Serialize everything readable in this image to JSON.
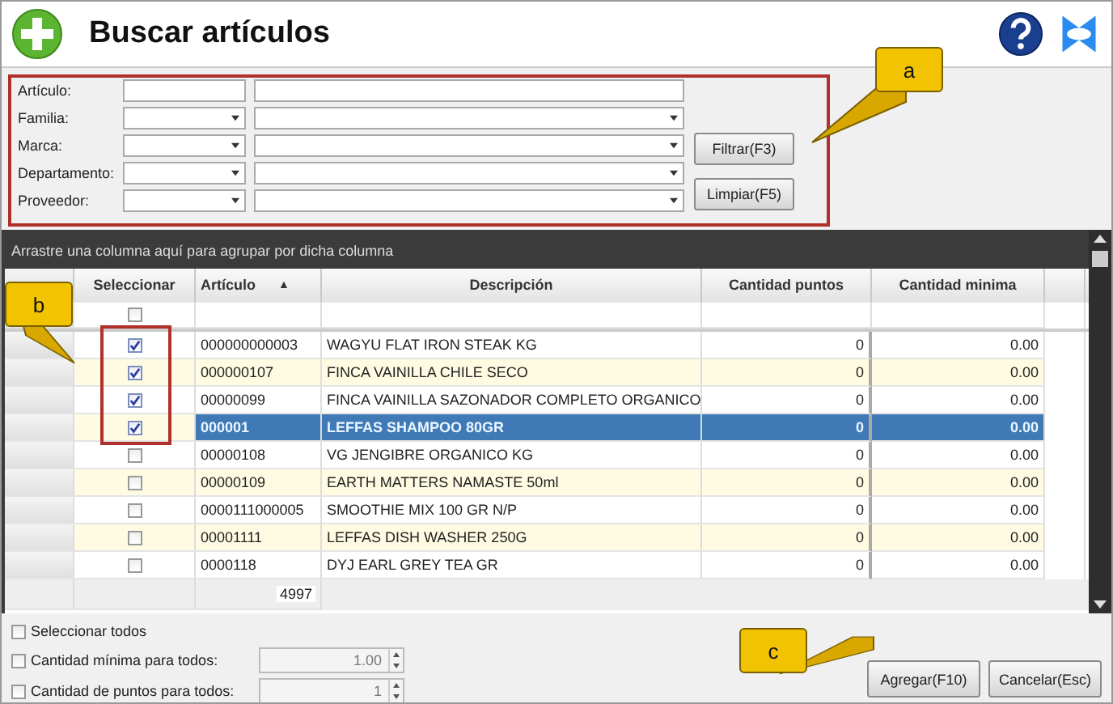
{
  "title": "Buscar artículos",
  "filters": [
    {
      "label": "Artículo:",
      "kind": "text"
    },
    {
      "label": "Familia:",
      "kind": "combo"
    },
    {
      "label": "Marca:",
      "kind": "combo"
    },
    {
      "label": "Departamento:",
      "kind": "combo"
    },
    {
      "label": "Proveedor:",
      "kind": "combo"
    }
  ],
  "filter_buttons": [
    "Filtrar(F3)",
    "Limpiar(F5)"
  ],
  "group_hint": "Arrastre una columna aquí para agrupar por dicha columna",
  "columns": [
    {
      "label": "Seleccionar"
    },
    {
      "label": "Artículo",
      "sort": "▲"
    },
    {
      "label": "Descripción"
    },
    {
      "label": "Cantidad puntos"
    },
    {
      "label": "Cantidad minima"
    }
  ],
  "filter_row_checked": false,
  "rows": [
    {
      "checked": true,
      "articulo": "000000000003",
      "descripcion": "WAGYU FLAT IRON STEAK KG",
      "puntos": "0",
      "minima": "0.00",
      "selected": false
    },
    {
      "checked": true,
      "articulo": "000000107",
      "descripcion": "FINCA VAINILLA CHILE SECO",
      "puntos": "0",
      "minima": "0.00",
      "selected": false
    },
    {
      "checked": true,
      "articulo": "00000099",
      "descripcion": "FINCA VAINILLA SAZONADOR COMPLETO ORGANICO",
      "puntos": "0",
      "minima": "0.00",
      "selected": false
    },
    {
      "checked": true,
      "articulo": "000001",
      "descripcion": "LEFFAS SHAMPOO 80GR",
      "puntos": "0",
      "minima": "0.00",
      "selected": true
    },
    {
      "checked": false,
      "articulo": "00000108",
      "descripcion": "VG JENGIBRE ORGANICO KG",
      "puntos": "0",
      "minima": "0.00",
      "selected": false
    },
    {
      "checked": false,
      "articulo": "00000109",
      "descripcion": "EARTH MATTERS NAMASTE 50ml",
      "puntos": "0",
      "minima": "0.00",
      "selected": false
    },
    {
      "checked": false,
      "articulo": "0000111000005",
      "descripcion": "SMOOTHIE MIX 100 GR  N/P",
      "puntos": "0",
      "minima": "0.00",
      "selected": false
    },
    {
      "checked": false,
      "articulo": "00001111",
      "descripcion": "LEFFAS DISH WASHER 250G",
      "puntos": "0",
      "minima": "0.00",
      "selected": false
    },
    {
      "checked": false,
      "articulo": "0000118",
      "descripcion": "DYJ EARL GREY TEA GR",
      "puntos": "0",
      "minima": "0.00",
      "selected": false
    }
  ],
  "footer_count": "4997",
  "options": [
    {
      "label": "Seleccionar todos",
      "checked": false,
      "kind": "check"
    },
    {
      "label": "Cantidad mínima para todos:",
      "checked": false,
      "kind": "spin",
      "value": "1.00"
    },
    {
      "label": "Cantidad de puntos para todos:",
      "checked": false,
      "kind": "spin",
      "value": "1"
    }
  ],
  "buttons": [
    "Agregar(F10)",
    "Cancelar(Esc)"
  ],
  "callouts": [
    "a",
    "b",
    "c"
  ]
}
